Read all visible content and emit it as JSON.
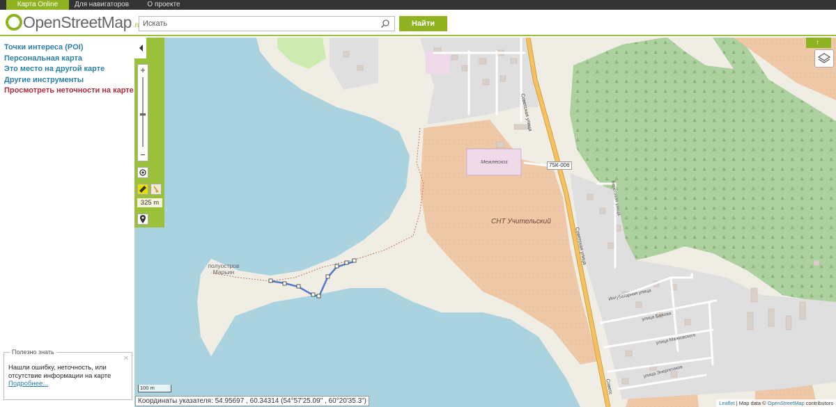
{
  "nav": {
    "tabs": [
      {
        "label": "Карта Online",
        "active": true
      },
      {
        "label": "Для навигаторов",
        "active": false
      },
      {
        "label": "О проекте",
        "active": false
      }
    ]
  },
  "header": {
    "logo_text": "OpenStreetMap",
    "logo_suffix": ".ru",
    "search_placeholder": "Искать",
    "find_label": "Найти"
  },
  "sidebar": {
    "links": [
      {
        "label": "Точки интереса (POI)",
        "color": "#2a7fa8"
      },
      {
        "label": "Персональная карта",
        "color": "#2a7fa8"
      },
      {
        "label": "Это место на другой карте",
        "color": "#2a7fa8"
      },
      {
        "label": "Другие инструменты",
        "color": "#2a7fa8"
      },
      {
        "label": "Просмотреть неточности на карте",
        "color": "#b02a3a"
      }
    ],
    "info": {
      "title": "Полезно знать",
      "close": "✕",
      "text": "Нашли ошибку, неточность, или отсутствие информации на карте",
      "more": "Подробнее..."
    }
  },
  "map": {
    "controls": {
      "zoom_in": "+",
      "zoom_out": "−",
      "measure_distance": "325 m"
    },
    "labels": {
      "peninsula": "полуостров Марьин",
      "snt": "СНТ Учительский",
      "school": "Межлесхоз",
      "road_ref": "75К-006",
      "sovetskaya": "Советская улица",
      "sovetskaya_short": "Советс",
      "beregovaya": "Береговая улица",
      "inkubatornaya": "Инкубаторная улица",
      "bazhova": "улица Бажова",
      "mayakovskogo": "улица Маяковского",
      "energetikov": "улица Энергетиков"
    },
    "scale_bar": "100 m",
    "coords": "Координаты указателя: 54.95697 , 60.34314 (54°57'25.09\" , 60°20'35.3\")",
    "attribution": {
      "leaflet": "Leaflet",
      "sep": " | Map data © ",
      "osm": "OpenStreetMap",
      "contrib": " contributors"
    }
  },
  "colors": {
    "accent": "#8fb220",
    "water": "#aad3df",
    "forest": "#add19e",
    "allotments": "#efc8a8",
    "residential": "#e0dfdf",
    "road": "#f7c25d"
  }
}
